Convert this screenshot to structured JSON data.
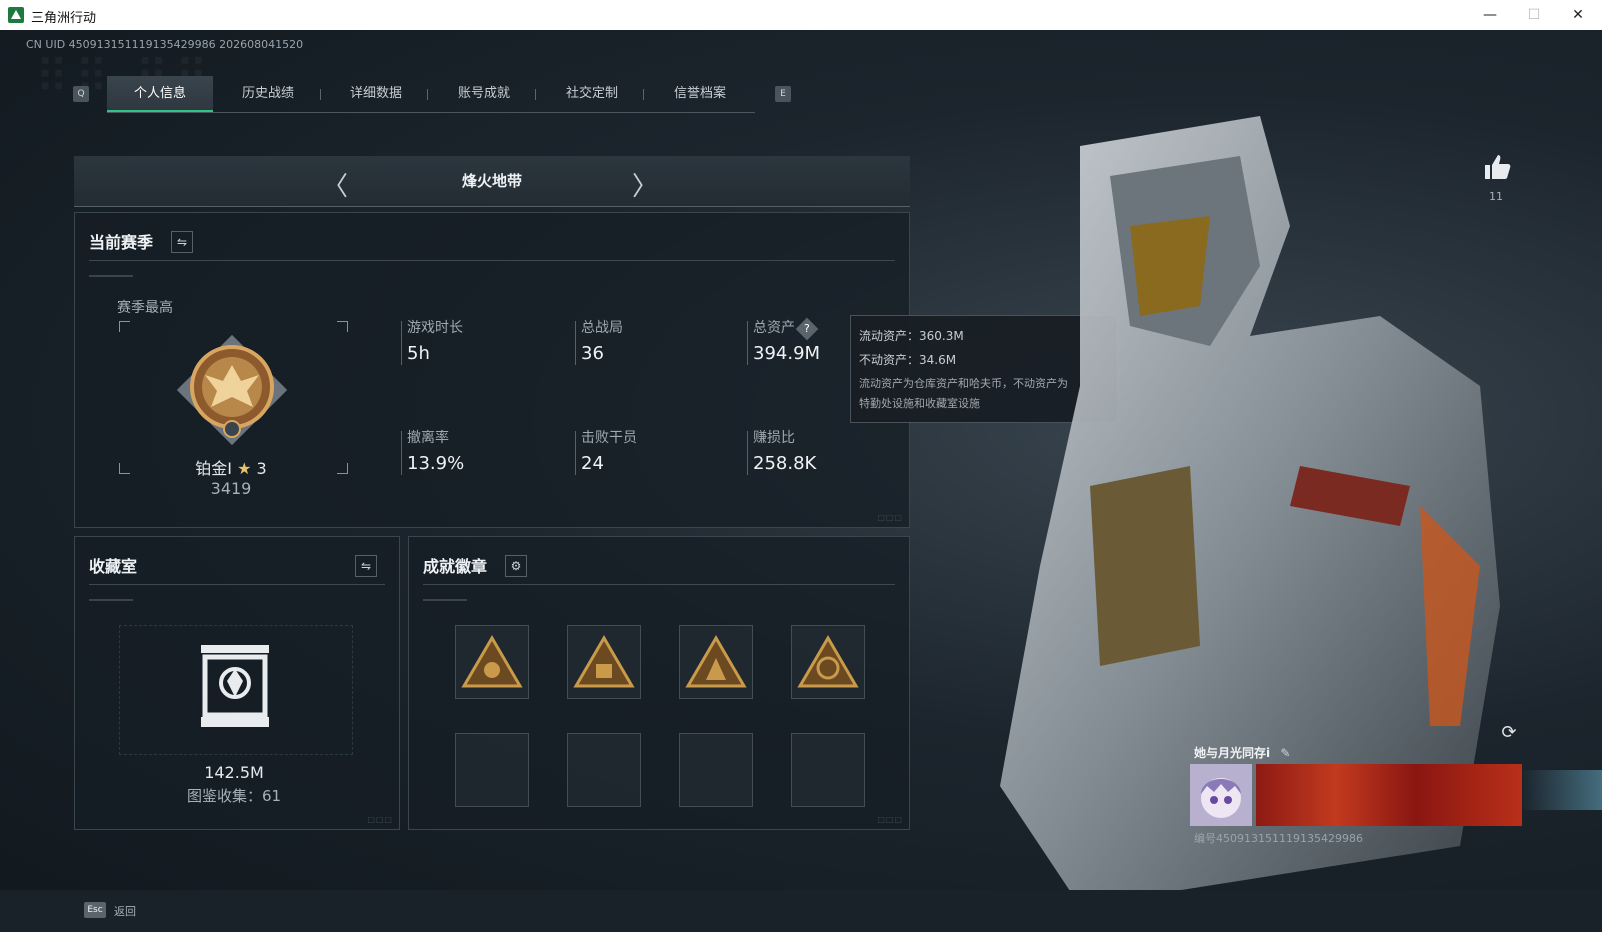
{
  "window": {
    "title": "三角洲行动",
    "minimize": "—",
    "maximize": "☐",
    "close": "✕"
  },
  "uid_line": "CN UID 450913151119135429986 202608041520",
  "tabs": {
    "left_key": "Q",
    "right_key": "E",
    "items": [
      {
        "label": "个人信息",
        "active": true
      },
      {
        "label": "历史战绩"
      },
      {
        "label": "详细数据"
      },
      {
        "label": "账号成就"
      },
      {
        "label": "社交定制"
      },
      {
        "label": "信誉档案"
      }
    ]
  },
  "mode": {
    "title": "烽火地带",
    "prev_icon": "chevron-left-icon",
    "next_icon": "chevron-right-icon"
  },
  "season": {
    "title": "当前赛季",
    "best_label": "赛季最高",
    "rank_name": "铂金I",
    "rank_stars": "3",
    "rank_score": "3419",
    "stats": [
      {
        "label": "游戏时长",
        "value": "5h"
      },
      {
        "label": "总战局",
        "value": "36"
      },
      {
        "label": "总资产",
        "value": "394.9M"
      },
      {
        "label": "撤离率",
        "value": "13.9%"
      },
      {
        "label": "击败干员",
        "value": "24"
      },
      {
        "label": "赚损比",
        "value": "258.8K"
      }
    ]
  },
  "tooltip": {
    "liquid": "流动资产：360.3M",
    "fixed": "不动资产：34.6M",
    "note1": "流动资产为仓库资产和哈夫币，不动资产为",
    "note2": "特勤处设施和收藏室设施"
  },
  "collection": {
    "title": "收藏室",
    "value": "142.5M",
    "count": "图鉴收集：61"
  },
  "badges": {
    "title": "成就徽章"
  },
  "likes": {
    "count": "11"
  },
  "card": {
    "name": "她与月光同存i",
    "uid": "编号450913151119135429986"
  },
  "footer": {
    "esc_key": "Esc",
    "back_label": "返回"
  },
  "colors": {
    "accent": "#2ec48a",
    "gold": "#c89a4a",
    "panel_bg": "#161e25"
  }
}
